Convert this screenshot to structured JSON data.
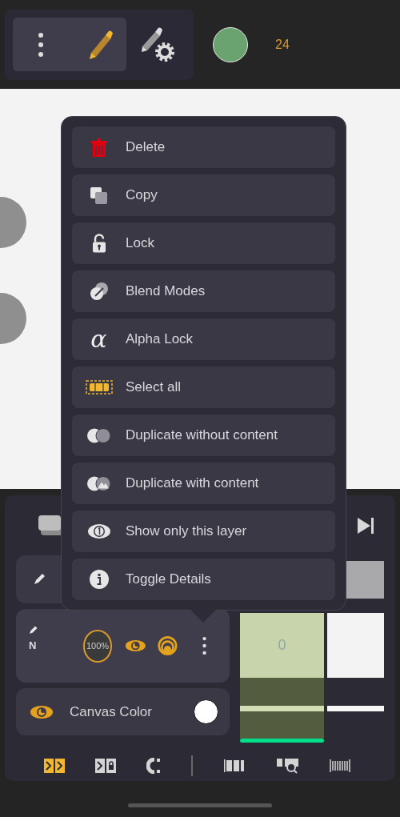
{
  "toolbar": {
    "tools": [
      {
        "kind": "brush",
        "selected": true
      },
      {
        "kind": "brush-settings",
        "selected": false
      }
    ],
    "brush": {
      "color": "#6aa36f",
      "size": "24"
    }
  },
  "menu": {
    "items": [
      {
        "label": "Delete",
        "kind": "delete"
      },
      {
        "label": "Copy",
        "kind": "copy"
      },
      {
        "label": "Lock",
        "kind": "lock"
      },
      {
        "label": "Blend Modes",
        "kind": "blend"
      },
      {
        "label": "Alpha Lock",
        "kind": "alpha",
        "glyph": "α"
      },
      {
        "label": "Select all",
        "kind": "select"
      },
      {
        "label": "Duplicate without content",
        "kind": "dup-empty"
      },
      {
        "label": "Duplicate with content",
        "kind": "dup-full"
      },
      {
        "label": "Show only this layer",
        "kind": "solo"
      },
      {
        "label": "Toggle Details",
        "kind": "info"
      }
    ]
  },
  "layer": {
    "blend": "N",
    "opacity": "100%",
    "frame_label": "0"
  },
  "canvas_color": {
    "label": "Canvas Color",
    "color": "#ffffff"
  }
}
